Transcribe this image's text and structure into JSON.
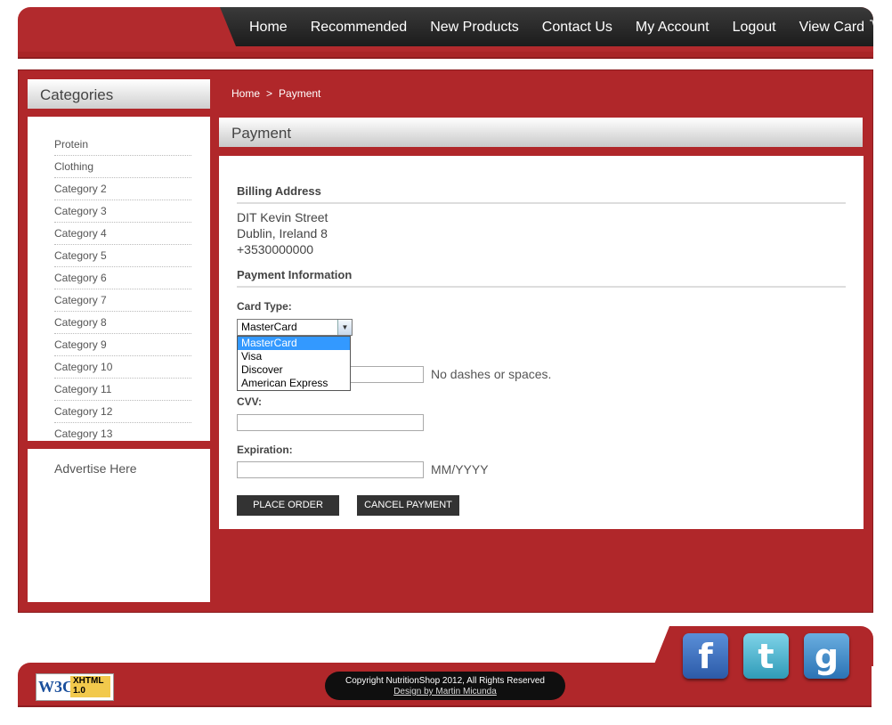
{
  "nav": {
    "items": [
      "Home",
      "Recommended",
      "New Products",
      "Contact Us",
      "My Account",
      "Logout",
      "View Card"
    ],
    "cart_icon": "cart-icon"
  },
  "sidebar": {
    "title": "Categories",
    "categories": [
      "Protein",
      "Clothing",
      "Category 2",
      "Category 3",
      "Category 4",
      "Category 5",
      "Category 6",
      "Category 7",
      "Category 8",
      "Category 9",
      "Category 10",
      "Category 11",
      "Category 12",
      "Category 13"
    ],
    "ad_text": "Advertise Here"
  },
  "breadcrumb": {
    "home": "Home",
    "separator": ">",
    "current": "Payment"
  },
  "payment": {
    "title": "Payment",
    "billing_title": "Billing Address",
    "address_lines": [
      "DIT Kevin Street",
      "Dublin, Ireland 8",
      "+3530000000"
    ],
    "info_title": "Payment Information",
    "card_type_label": "Card Type:",
    "card_type_selected": "MasterCard",
    "card_type_options": [
      "MasterCard",
      "Visa",
      "Discover",
      "American Express"
    ],
    "card_number_hint": "No dashes or spaces.",
    "cvv_label": "CVV:",
    "expiration_label": "Expiration:",
    "expiration_hint": "MM/YYYY",
    "place_order": "PLACE ORDER",
    "cancel_payment": "CANCEL PAYMENT"
  },
  "footer": {
    "badge_w3c": "W3C",
    "badge_xhtml": "XHTML",
    "badge_version": "1.0",
    "copyright": "Copyright NutritionShop 2012, All Rights Reserved",
    "design": "Design by Martin Micunda",
    "social": [
      "facebook-icon",
      "twitter-icon",
      "google-icon"
    ]
  },
  "colors": {
    "brand_red": "#b0272a",
    "nav_dark": "#1c1c1c",
    "select_highlight": "#3399ff"
  }
}
